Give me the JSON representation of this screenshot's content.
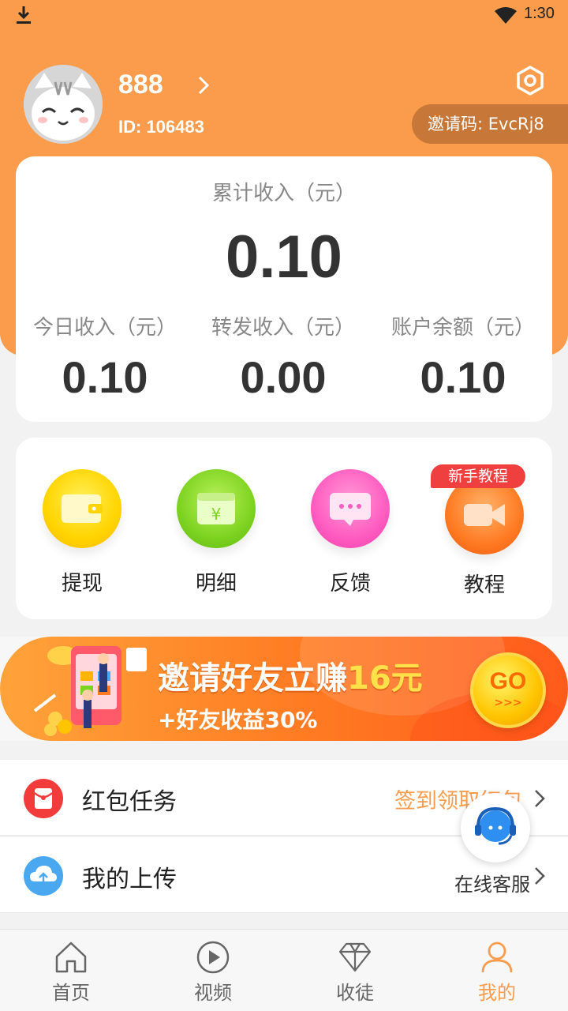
{
  "status_bar": {
    "time": "1:30"
  },
  "user": {
    "name": "888",
    "id": "ID: 106483",
    "invite_code": "邀请码: EvcRj8"
  },
  "income": {
    "total_label": "累计收入（元）",
    "total_value": "0.10",
    "stats": [
      {
        "label": "今日收入（元）",
        "value": "0.10"
      },
      {
        "label": "转发收入（元）",
        "value": "0.00"
      },
      {
        "label": "账户余额（元）",
        "value": "0.10"
      }
    ]
  },
  "menu": {
    "items": [
      {
        "label": "提现",
        "icon": "wallet-icon"
      },
      {
        "label": "明细",
        "icon": "calendar-yuan-icon"
      },
      {
        "label": "反馈",
        "icon": "chat-bubble-icon"
      },
      {
        "label": "教程",
        "icon": "video-camera-icon"
      }
    ],
    "badge": "新手教程"
  },
  "banner": {
    "title_prefix": "邀请好友立赚",
    "title_amount": "16元",
    "subtitle": "+好友收益30%",
    "go_label": "GO",
    "go_arrows": ">>>"
  },
  "list": [
    {
      "title": "红包任务",
      "right_text": "签到领取红包",
      "icon": "red-packet-icon"
    },
    {
      "title": "我的上传",
      "right_text": "",
      "icon": "cloud-upload-icon"
    }
  ],
  "customer_service": {
    "label": "在线客服"
  },
  "tabs": [
    {
      "label": "首页",
      "icon": "home-icon"
    },
    {
      "label": "视频",
      "icon": "play-icon"
    },
    {
      "label": "收徒",
      "icon": "diamond-icon"
    },
    {
      "label": "我的",
      "icon": "person-icon",
      "active": true
    }
  ],
  "colors": {
    "primary": "#fb9c4c",
    "badge_red": "#ef3f3f",
    "text_dark": "#333333"
  }
}
